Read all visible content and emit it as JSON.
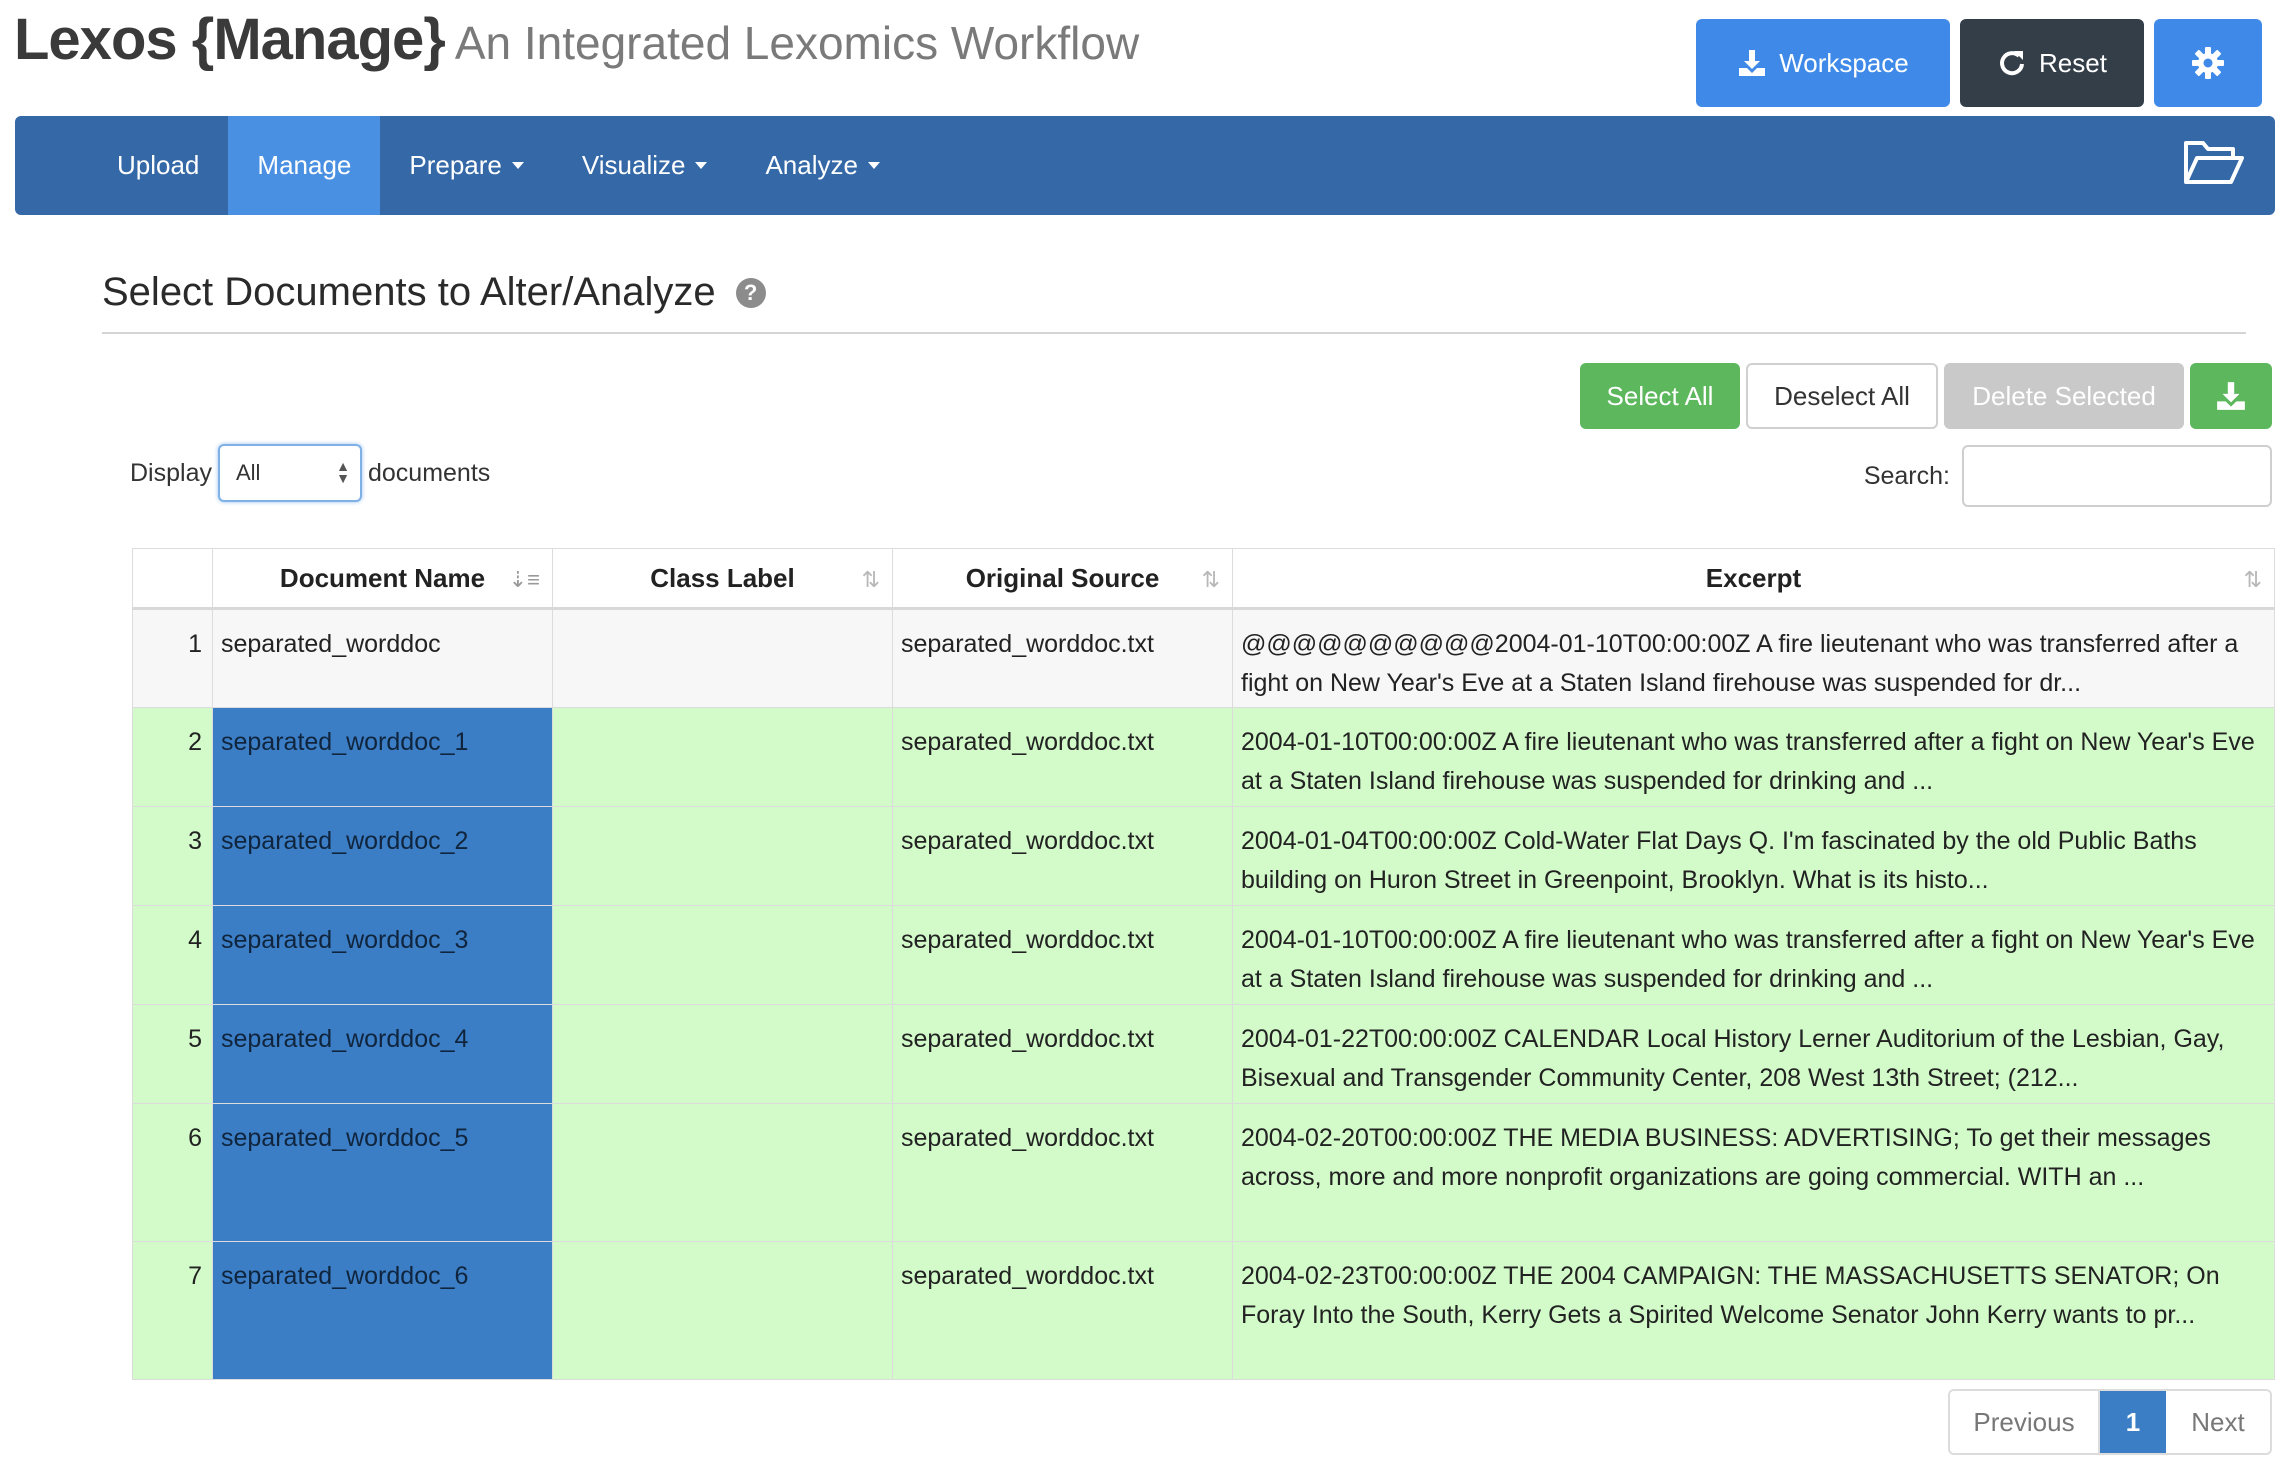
{
  "header": {
    "brand_main": "Lexos {Manage}",
    "brand_sub": "An Integrated Lexomics Workflow",
    "workspace_label": "Workspace",
    "reset_label": "Reset"
  },
  "nav": {
    "upload": "Upload",
    "manage": "Manage",
    "prepare": "Prepare",
    "visualize": "Visualize",
    "analyze": "Analyze"
  },
  "section": {
    "title": "Select Documents to Alter/Analyze",
    "help": "?"
  },
  "actions": {
    "select_all": "Select All",
    "deselect_all": "Deselect All",
    "delete_selected": "Delete Selected"
  },
  "display": {
    "label": "Display",
    "value": "All",
    "suffix": "documents"
  },
  "search": {
    "label": "Search:",
    "value": ""
  },
  "table": {
    "headers": {
      "name": "Document Name",
      "class": "Class Label",
      "source": "Original Source",
      "excerpt": "Excerpt"
    },
    "rows": [
      {
        "num": "1",
        "name": "separated_worddoc",
        "class": "",
        "source": "separated_worddoc.txt",
        "excerpt": "@@@@@@@@@@2004-01-10T00:00:00Z A fire lieutenant who was transferred after a fight on New Year's Eve at a Staten Island firehouse was suspended for dr..."
      },
      {
        "num": "2",
        "name": "separated_worddoc_1",
        "class": "",
        "source": "separated_worddoc.txt",
        "excerpt": "2004-01-10T00:00:00Z A fire lieutenant who was transferred after a fight on New Year's Eve at a Staten Island firehouse was suspended for drinking and ..."
      },
      {
        "num": "3",
        "name": "separated_worddoc_2",
        "class": "",
        "source": "separated_worddoc.txt",
        "excerpt": "2004-01-04T00:00:00Z Cold-Water Flat Days Q. I'm fascinated by the old Public Baths building on Huron Street in Greenpoint, Brooklyn. What is its histo..."
      },
      {
        "num": "4",
        "name": "separated_worddoc_3",
        "class": "",
        "source": "separated_worddoc.txt",
        "excerpt": "2004-01-10T00:00:00Z A fire lieutenant who was transferred after a fight on New Year's Eve at a Staten Island firehouse was suspended for drinking and ..."
      },
      {
        "num": "5",
        "name": "separated_worddoc_4",
        "class": "",
        "source": "separated_worddoc.txt",
        "excerpt": "2004-01-22T00:00:00Z CALENDAR Local History Lerner Auditorium of the Lesbian, Gay, Bisexual and Transgender Community Center, 208 West 13th Street; (212..."
      },
      {
        "num": "6",
        "name": "separated_worddoc_5",
        "class": "",
        "source": "separated_worddoc.txt",
        "excerpt": "2004-02-20T00:00:00Z THE MEDIA BUSINESS: ADVERTISING; To get their messages across, more and more nonprofit organizations are going commercial. WITH an ..."
      },
      {
        "num": "7",
        "name": "separated_worddoc_6",
        "class": "",
        "source": "separated_worddoc.txt",
        "excerpt": "2004-02-23T00:00:00Z THE 2004 CAMPAIGN: THE MASSACHUSETTS SENATOR; On Foray Into the South, Kerry Gets a Spirited Welcome Senator John Kerry wants to pr..."
      }
    ]
  },
  "pagination": {
    "previous": "Previous",
    "current": "1",
    "next": "Next"
  },
  "colors": {
    "nav_bg": "#3468a7",
    "nav_active": "#4a90e2",
    "selected_row": "#d2fbc9",
    "selected_name": "#3b7ec5",
    "green_btn": "#5db75d"
  }
}
